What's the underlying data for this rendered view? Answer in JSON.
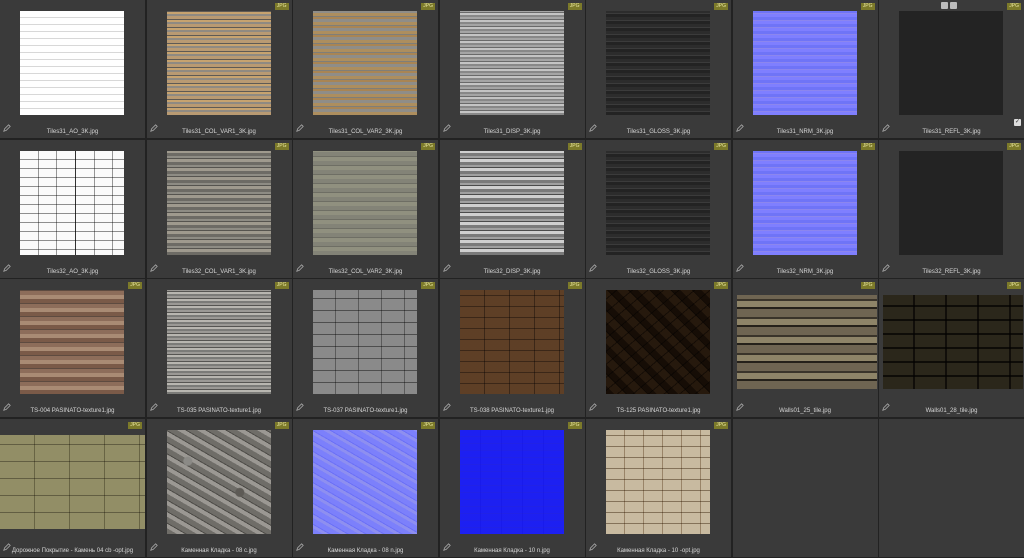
{
  "badge_label": "JPG",
  "items": [
    {
      "label": "Tiles31_AO_3K.jpg",
      "badge": "",
      "texture": "ao"
    },
    {
      "label": "Tiles31_COL_VAR1_3K.jpg",
      "badge": "JPG",
      "texture": "col1"
    },
    {
      "label": "Tiles31_COL_VAR2_3K.jpg",
      "badge": "JPG",
      "texture": "col2"
    },
    {
      "label": "Tiles31_DISP_3K.jpg",
      "badge": "JPG",
      "texture": "disp"
    },
    {
      "label": "Tiles31_GLOSS_3K.jpg",
      "badge": "JPG",
      "texture": "gloss"
    },
    {
      "label": "Tiles31_NRM_3K.jpg",
      "badge": "JPG",
      "texture": "nrm"
    },
    {
      "label": "Tiles31_REFL_3K.jpg",
      "badge": "JPG",
      "texture": "refl",
      "selected": true
    },
    {
      "label": "Tiles32_AO_3K.jpg",
      "badge": "",
      "texture": "ao2"
    },
    {
      "label": "Tiles32_COL_VAR1_3K.jpg",
      "badge": "JPG",
      "texture": "col1b"
    },
    {
      "label": "Tiles32_COL_VAR2_3K.jpg",
      "badge": "JPG",
      "texture": "col2b"
    },
    {
      "label": "Tiles32_DISP_3K.jpg",
      "badge": "JPG",
      "texture": "disp2"
    },
    {
      "label": "Tiles32_GLOSS_3K.jpg",
      "badge": "JPG",
      "texture": "gloss"
    },
    {
      "label": "Tiles32_NRM_3K.jpg",
      "badge": "JPG",
      "texture": "nrm"
    },
    {
      "label": "Tiles32_REFL_3K.jpg",
      "badge": "JPG",
      "texture": "refl"
    },
    {
      "label": "TS-004 PASINATO-texture1.jpg",
      "badge": "JPG",
      "texture": "ts004"
    },
    {
      "label": "TS-035 PASINATO-texture1.jpg",
      "badge": "JPG",
      "texture": "ts035"
    },
    {
      "label": "TS-037 PASINATO-texture1.jpg",
      "badge": "JPG",
      "texture": "ts037"
    },
    {
      "label": "TS-038 PASINATO-texture1.jpg",
      "badge": "JPG",
      "texture": "ts038"
    },
    {
      "label": "TS-125 PASINATO-texture1.jpg",
      "badge": "JPG",
      "texture": "ts125"
    },
    {
      "label": "Walls01_25_tile.jpg",
      "badge": "JPG",
      "texture": "walls25",
      "wide": true
    },
    {
      "label": "Walls01_28_tile.jpg",
      "badge": "JPG",
      "texture": "walls28",
      "wide": true
    },
    {
      "label": "Дорожное Покрытие - Камень 04 cb -opt.jpg",
      "badge": "JPG",
      "texture": "road",
      "wide": true
    },
    {
      "label": "Каменная Кладка - 08 c.jpg",
      "badge": "JPG",
      "texture": "kk08c"
    },
    {
      "label": "Каменная Кладка - 08 n.jpg",
      "badge": "JPG",
      "texture": "kk08n"
    },
    {
      "label": "Каменная Кладка - 10 n.jpg",
      "badge": "JPG",
      "texture": "kk10n"
    },
    {
      "label": "Каменная Кладка - 10 -opt.jpg",
      "badge": "JPG",
      "texture": "kk10"
    }
  ]
}
